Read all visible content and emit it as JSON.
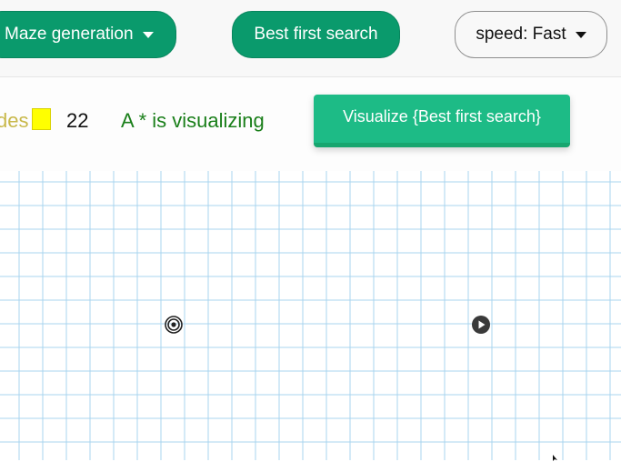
{
  "navbar": {
    "maze_generation_label": "Maze generation",
    "algorithm_label": "Best first search",
    "speed_label": "speed: Fast"
  },
  "info": {
    "legend_label": "des",
    "legend_color": "#ffff00",
    "count": "22",
    "status": "A * is visualizing",
    "visualize_label": "Visualize {Best first search}"
  },
  "grid": {
    "line_color": "#a8d4ef",
    "target_icon": "target-icon",
    "start_icon": "start-icon"
  },
  "colors": {
    "primary_green": "#0a9a6c",
    "visualize_green": "#1dbb86",
    "status_green": "#1a7f1a"
  }
}
